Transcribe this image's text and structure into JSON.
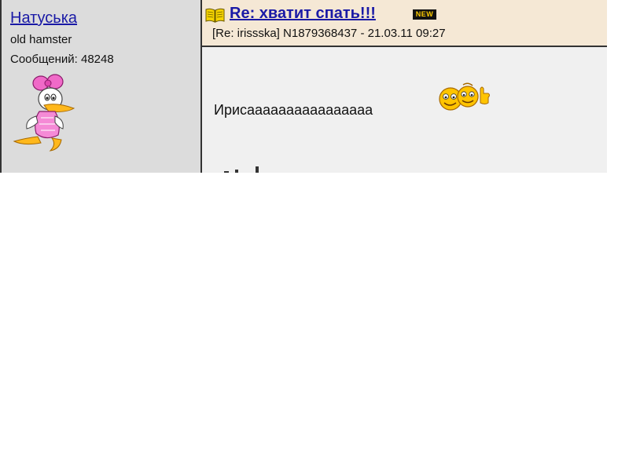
{
  "post": {
    "author": {
      "name": "Натуська",
      "rank": "old hamster",
      "messages_label": "Сообщений: 48248",
      "avatar_icon": "daisy-duck-avatar-icon"
    },
    "header": {
      "title": "Re: хватит спать!!!",
      "new_badge": "NEW",
      "meta": "[Re: irissska]  N1879368437 - 21.03.11 09:27",
      "topic_icon": "open-book-icon"
    },
    "body": {
      "text": "Ирисаааааааааааааааа",
      "emoticon": "smileys-thumbs-up-icon"
    },
    "colors": {
      "header_bg": "#f5e8d5",
      "author_bg": "#dcdcdc",
      "body_bg": "#f0f0f0",
      "link": "#1a1aa6",
      "badge_bg": "#111111",
      "badge_fg": "#ffcc00"
    }
  }
}
